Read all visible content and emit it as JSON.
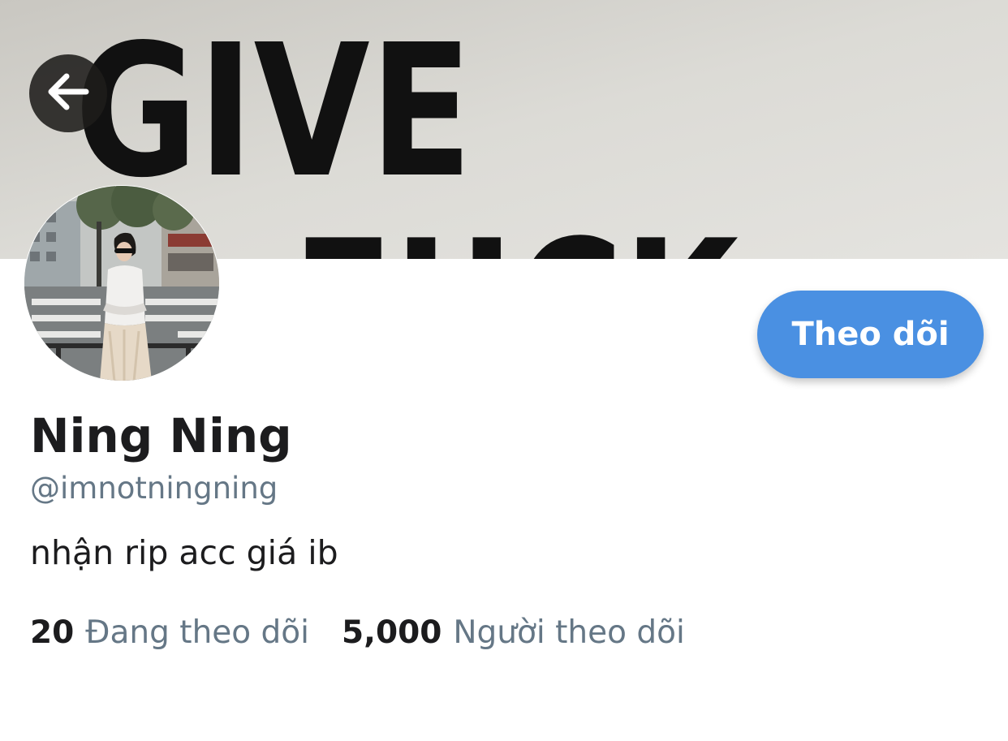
{
  "banner": {
    "text_line1": "GIVE",
    "text_line2": "FUCK"
  },
  "profile": {
    "display_name": "Ning Ning",
    "handle": "@imnotningning",
    "bio": "nhận rip acc giá ib"
  },
  "actions": {
    "follow_label": "Theo dõi"
  },
  "stats": {
    "following_count": "20",
    "following_label": "Đang theo dõi",
    "followers_count": "5,000",
    "followers_label": "Người theo dõi"
  },
  "icons": {
    "back": "arrow-left-icon"
  },
  "colors": {
    "accent": "#4a90e2",
    "secondary_text": "#657786",
    "primary_text": "#1c1c1e",
    "banner_bg": "#d8d7d2"
  }
}
